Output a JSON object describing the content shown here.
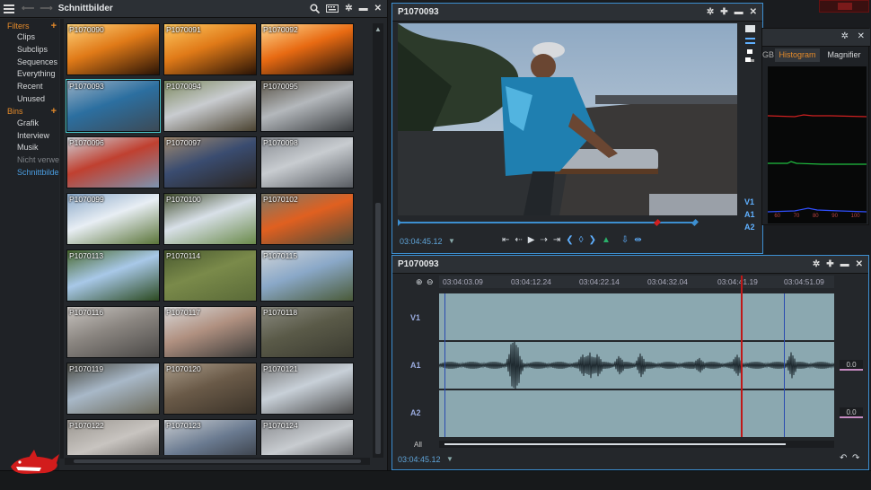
{
  "browser": {
    "title": "Schnittbilder",
    "filters_label": "Filters",
    "filters": [
      "Clips",
      "Subclips",
      "Sequences",
      "Everything",
      "Recent",
      "Unused"
    ],
    "bins_label": "Bins",
    "bins": [
      "Grafik",
      "Interview",
      "Musik",
      "Nicht verwer",
      "Schnittbilder"
    ],
    "clips": [
      "P1070090",
      "P1070091",
      "P1070092",
      "P1070093",
      "P1070094",
      "P1070095",
      "P1070096",
      "P1070097",
      "P1070098",
      "P1070099",
      "P1070100",
      "P1070102",
      "P1070113",
      "P1070114",
      "P1070115",
      "P1070116",
      "P1070117",
      "P1070118",
      "P1070119",
      "P1070120",
      "P1070121",
      "P1070122",
      "P1070123",
      "P1070124"
    ]
  },
  "viewer": {
    "title": "P1070093",
    "timecode": "03:04:45.12",
    "track_v1": "V1",
    "track_a1": "A1",
    "track_a2": "A2"
  },
  "scopes": {
    "tab_rgb": "GB",
    "tab_histogram": "Histogram",
    "tab_magnifier": "Magnifier",
    "axis_ticks": [
      "60",
      "70",
      "80",
      "90",
      "100"
    ]
  },
  "timeline": {
    "title": "P1070093",
    "ruler": [
      "03:04:03.09",
      "03:04:12.24",
      "03:04:22.14",
      "03:04:32.04",
      "03:04:41.19",
      "03:04:51.09"
    ],
    "track_v1": "V1",
    "track_a1": "A1",
    "track_a2": "A2",
    "all_label": "All",
    "a1_level": "0.0",
    "a2_level": "0.0",
    "timecode": "03:04:45.12"
  },
  "colors": {
    "accent": "#3d8fd1",
    "orange": "#e48a2a",
    "playhead": "#d02020",
    "selection": "#49c6c8"
  },
  "icons": [
    "menu-icon",
    "search-icon",
    "keyboard-icon",
    "gear-icon",
    "minimize-icon",
    "close-icon",
    "pin-icon",
    "plus-icon",
    "folder-icon",
    "shark-logo-icon"
  ]
}
